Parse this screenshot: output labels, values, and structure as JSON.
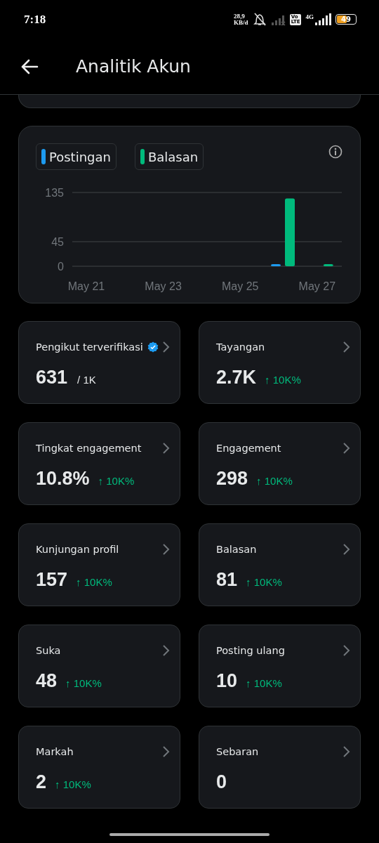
{
  "status_bar": {
    "time": "7:18",
    "data_rate": [
      "28,9",
      "KB/d"
    ],
    "volte": [
      "Vo",
      "LTE"
    ],
    "network": "4G",
    "battery": "49"
  },
  "header": {
    "title": "Analitik Akun"
  },
  "chart_card": {
    "chart_data": {
      "type": "bar",
      "categories": [
        "May 21",
        null,
        "May 23",
        null,
        "May 25",
        null,
        "May 27"
      ],
      "yticks": [
        0,
        45,
        135
      ],
      "ylim": [
        0,
        135
      ],
      "series": [
        {
          "name": "Postingan",
          "color": "#1d9bf0",
          "values": [
            0,
            0,
            0,
            0,
            0,
            2,
            0
          ]
        },
        {
          "name": "Balasan",
          "color": "#00ba7c",
          "values": [
            0,
            0,
            0,
            0,
            0,
            124,
            3
          ]
        }
      ]
    }
  },
  "metrics": [
    {
      "label": "Pengikut terverifikasi",
      "verified": true,
      "value": "631",
      "suffix": "/ 1K"
    },
    {
      "label": "Tayangan",
      "value": "2.7K",
      "change": "↑ 10K%"
    },
    {
      "label": "Tingkat engagement",
      "value": "10.8%",
      "change": "↑ 10K%"
    },
    {
      "label": "Engagement",
      "value": "298",
      "change": "↑ 10K%"
    },
    {
      "label": "Kunjungan profil",
      "value": "157",
      "change": "↑ 10K%"
    },
    {
      "label": "Balasan",
      "value": "81",
      "change": "↑ 10K%"
    },
    {
      "label": "Suka",
      "value": "48",
      "change": "↑ 10K%"
    },
    {
      "label": "Posting ulang",
      "value": "10",
      "change": "↑ 10K%"
    },
    {
      "label": "Markah",
      "value": "2",
      "change": "↑ 10K%"
    },
    {
      "label": "Sebaran",
      "value": "0"
    }
  ]
}
